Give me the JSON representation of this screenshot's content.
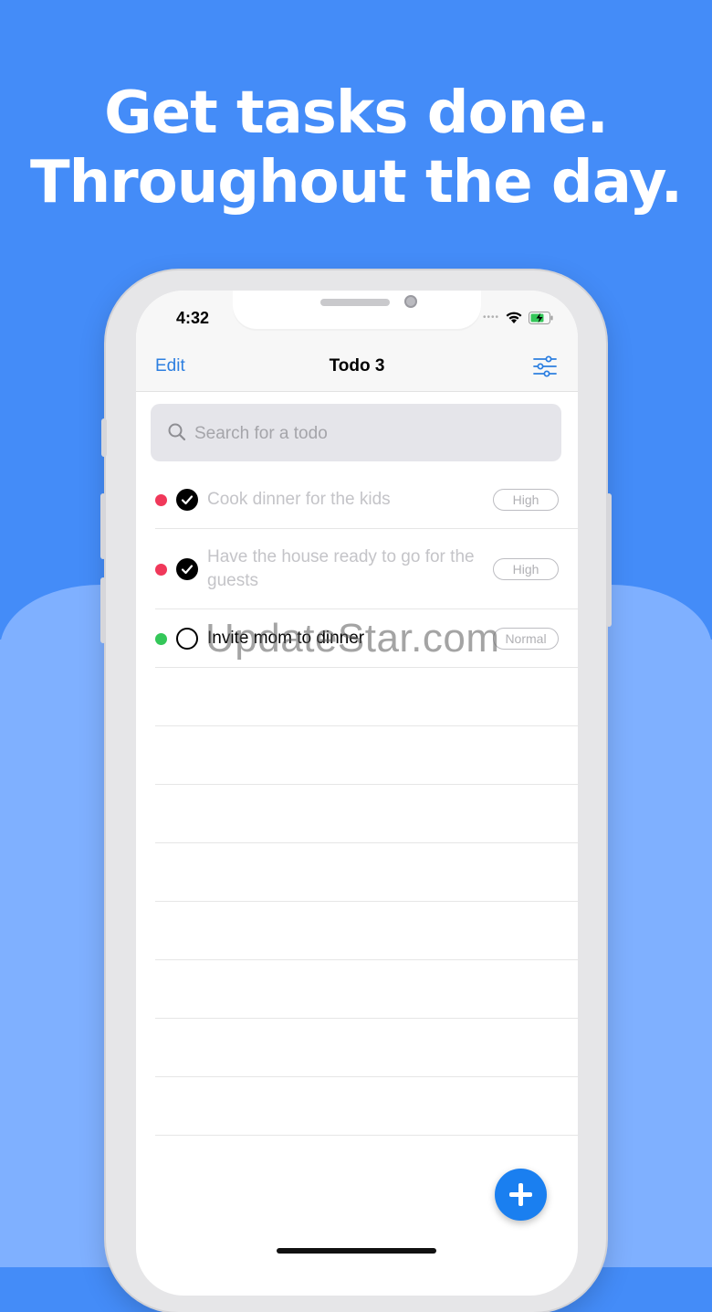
{
  "promo": {
    "headline_line1": "Get tasks done.",
    "headline_line2": "Throughout the day."
  },
  "status_bar": {
    "time": "4:32",
    "icons": [
      "signal-dots-icon",
      "wifi-icon",
      "battery-charging-icon"
    ]
  },
  "nav": {
    "edit_label": "Edit",
    "title": "Todo 3",
    "filter_icon": "sliders-icon"
  },
  "search": {
    "placeholder": "Search for a todo",
    "icon": "search-icon"
  },
  "todos": [
    {
      "text": "Cook dinner for the kids",
      "priority": "High",
      "done": true,
      "dot_color": "#f0385a"
    },
    {
      "text": "Have the house ready to go for the guests",
      "priority": "High",
      "done": true,
      "dot_color": "#f0385a"
    },
    {
      "text": "Invite mom to dinner",
      "priority": "Normal",
      "done": false,
      "dot_color": "#34c759"
    }
  ],
  "watermark": "UpdateStar.com",
  "add_button": {
    "icon": "plus-icon"
  },
  "colors": {
    "background_top": "#448cf8",
    "background_bottom": "#7fb0ff",
    "accent": "#2d7fe0",
    "fab": "#1a7ff0",
    "high_priority": "#f0385a",
    "normal_priority": "#34c759"
  }
}
